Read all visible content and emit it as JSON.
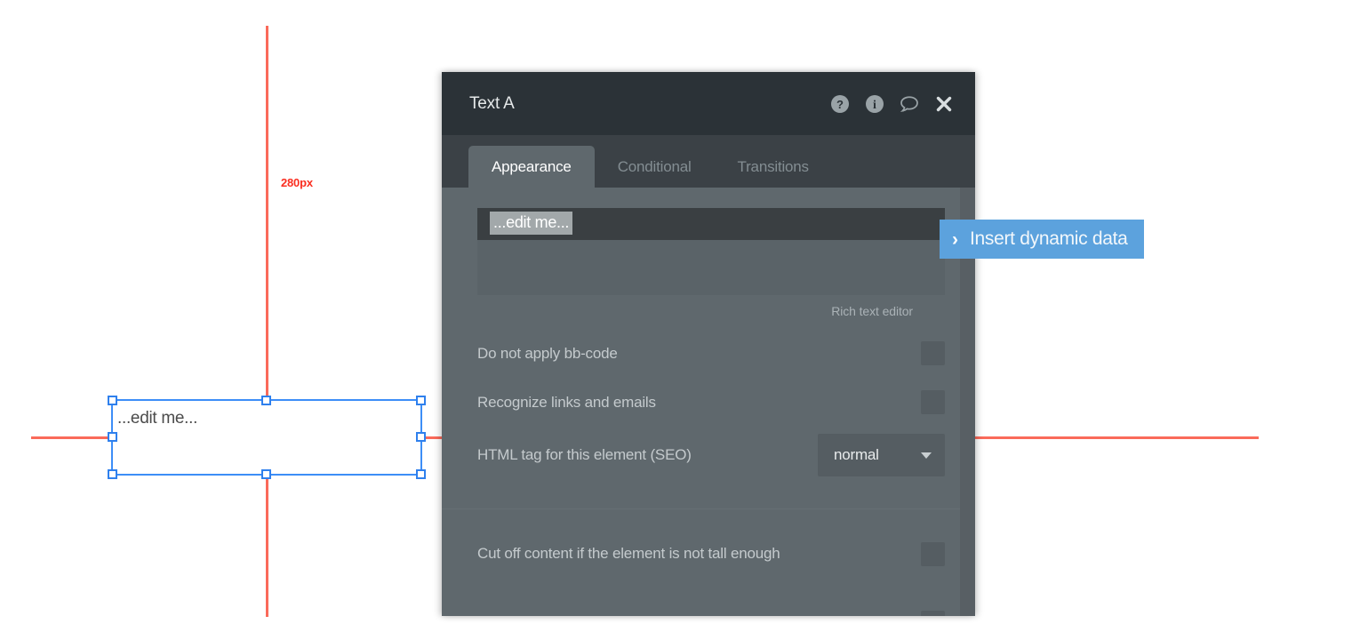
{
  "canvas": {
    "guide_label": "280px",
    "guide_color": "#fa6a5a",
    "selection_color": "#3d8ef7",
    "element_text": "...edit me..."
  },
  "panel": {
    "title": "Text A",
    "header_icons": [
      {
        "name": "help-icon",
        "glyph": "?"
      },
      {
        "name": "info-icon",
        "glyph": "i"
      },
      {
        "name": "comment-icon",
        "glyph": "speech-bubble"
      },
      {
        "name": "close-icon",
        "glyph": "x"
      }
    ],
    "tabs": [
      {
        "label": "Appearance",
        "active": true
      },
      {
        "label": "Conditional",
        "active": false
      },
      {
        "label": "Transitions",
        "active": false
      }
    ],
    "editor": {
      "content_token": "...edit me...",
      "caption": "Rich text editor"
    },
    "rows": [
      {
        "label": "Do not apply bb-code",
        "control": "checkbox",
        "checked": false
      },
      {
        "label": "Recognize links and emails",
        "control": "checkbox",
        "checked": false
      },
      {
        "label": "HTML tag for this element (SEO)",
        "control": "dropdown",
        "value": "normal"
      },
      {
        "label": "Cut off content if the element is not tall enough",
        "control": "checkbox",
        "checked": false
      }
    ]
  },
  "insert_dynamic_data": {
    "label": "Insert dynamic data",
    "chevron": "›",
    "color": "#5ca2dd"
  }
}
